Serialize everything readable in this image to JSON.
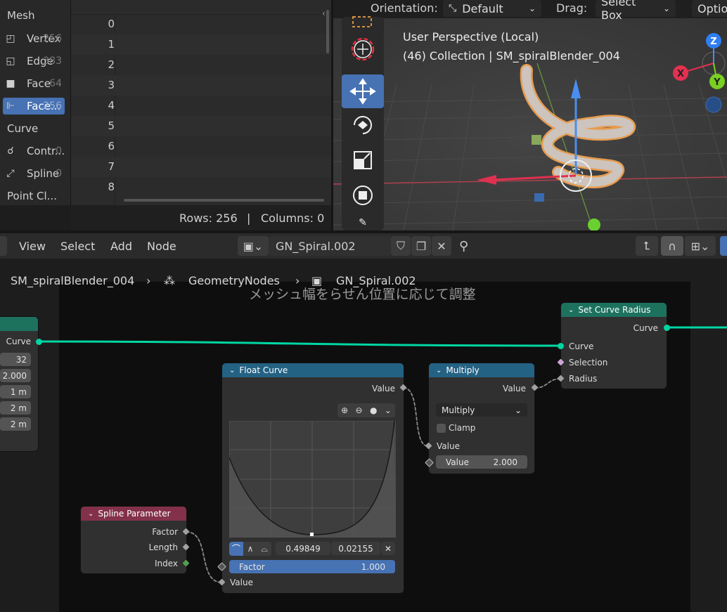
{
  "spreadsheet": {
    "sidebar": {
      "mesh_header": "Mesh",
      "items_mesh": [
        {
          "label": "Vertex",
          "count": "256",
          "icon": "vertex-icon"
        },
        {
          "label": "Edge",
          "count": "383",
          "icon": "edge-icon"
        },
        {
          "label": "Face",
          "count": "64",
          "icon": "face-icon"
        },
        {
          "label": "Face...",
          "count": "256",
          "icon": "face-corner-icon",
          "active": true
        }
      ],
      "curve_header": "Curve",
      "items_curve": [
        {
          "label": "Contr...",
          "count": "0",
          "icon": "control-point-icon"
        },
        {
          "label": "Spline",
          "count": "0",
          "icon": "spline-icon"
        }
      ],
      "pointcloud_header": "Point Cl..."
    },
    "rows": [
      "0",
      "1",
      "2",
      "3",
      "4",
      "5",
      "6",
      "7",
      "8"
    ],
    "footer": {
      "rows": "Rows: 256",
      "sep": "|",
      "columns": "Columns: 0"
    }
  },
  "viewport": {
    "orientation_label": "Orientation:",
    "orientation_value": "Default",
    "drag_label": "Drag:",
    "drag_value": "Select Box",
    "options_label": "Optio",
    "perspective": "User Perspective (Local)",
    "collection": "(46) Collection | SM_spiralBlender_004",
    "gizmo": {
      "z": "Z",
      "y": "Y",
      "x": "X"
    }
  },
  "node_editor": {
    "menus": [
      "View",
      "Select",
      "Add",
      "Node"
    ],
    "tree_name": "GN_Spiral.002",
    "breadcrumb": {
      "object": "SM_spiralBlender_004",
      "modifier": "GeometryNodes",
      "tree": "GN_Spiral.002"
    },
    "frame_label": "メッシュ幅をらせん位置に応じて調整",
    "left_node": {
      "curve_label": "Curve",
      "fields": [
        "32",
        "2.000",
        "1 m",
        "2 m",
        "2 m"
      ]
    },
    "set_curve_radius": {
      "title": "Set Curve Radius",
      "out_curve": "Curve",
      "in_curve": "Curve",
      "in_selection": "Selection",
      "in_radius": "Radius"
    },
    "float_curve": {
      "title": "Float Curve",
      "out_value": "Value",
      "point_x": "0.49849",
      "point_y": "0.02155",
      "factor_label": "Factor",
      "factor_value": "1.000",
      "in_value": "Value"
    },
    "multiply": {
      "title": "Multiply",
      "out_value": "Value",
      "operation": "Multiply",
      "clamp_label": "Clamp",
      "in_value": "Value",
      "value_label": "Value",
      "value_field": "2.000"
    },
    "spline_parameter": {
      "title": "Spline Parameter",
      "factor": "Factor",
      "length": "Length",
      "index": "Index"
    }
  },
  "colors": {
    "accent": "#4772b3",
    "geometry_socket": "#00d6a3",
    "geo_node_header": "#1d725e",
    "converter_header": "#246283",
    "input_header": "#83314a"
  }
}
